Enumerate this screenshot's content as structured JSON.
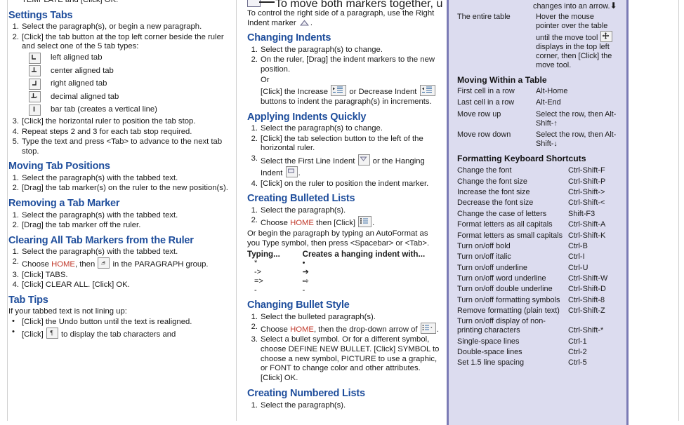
{
  "meta": {
    "doc_kind": "quick-reference-card",
    "accent_heading_color": "#1f4e9c",
    "accent_emphasis_color": "#c0392b",
    "panel_background_color": "#dcdcef",
    "panel_border_color": "#7b7bb5"
  },
  "left_column": {
    "top_cut_line": "TEMPLATE and [Click] OK.",
    "sections": [
      {
        "heading": "Settings Tabs",
        "steps": [
          "Select the paragraph(s), or begin a new paragraph.",
          "[Click] the tab button at the top left corner beside the ruler and select one of the 5 tab types:"
        ],
        "tab_types": [
          {
            "icon": "left-tab-icon",
            "label": "left aligned tab"
          },
          {
            "icon": "center-tab-icon",
            "label": "center aligned tab"
          },
          {
            "icon": "right-tab-icon",
            "label": "right aligned tab"
          },
          {
            "icon": "decimal-tab-icon",
            "label": "decimal aligned tab"
          },
          {
            "icon": "bar-tab-icon",
            "label": "bar tab (creates a vertical line)"
          }
        ],
        "steps_after": [
          "[Click] the horizontal ruler to position the tab stop.",
          "Repeat steps 2 and 3 for each tab stop required.",
          "Type the text and press <Tab> to advance to the next tab stop."
        ]
      },
      {
        "heading": "Moving Tab Positions",
        "steps": [
          "Select the paragraph(s) with the tabbed text.",
          "[Drag] the tab marker(s) on the ruler to the new position(s)."
        ]
      },
      {
        "heading": "Removing a Tab Marker",
        "steps": [
          "Select the paragraph(s) with the tabbed text.",
          "[Drag] the tab marker off the ruler."
        ]
      },
      {
        "heading": "Clearing All Tab Markers from the Ruler",
        "steps_parts": [
          {
            "plain": "Select the paragraph(s) with the tabbed text."
          },
          {
            "pre": "Choose ",
            "emph": "HOME",
            "mid": ", then ",
            "icon": "dialog-launcher-icon",
            "post": " in the PARAGRAPH group."
          },
          {
            "plain": "[Click] TABS."
          },
          {
            "plain": "[Click] CLEAR ALL. [Click] OK."
          }
        ]
      },
      {
        "heading": "Tab Tips",
        "intro": "If your tabbed text is not lining up:",
        "bullets": [
          {
            "plain": "[Click] the Undo button until the text is realigned."
          },
          {
            "pre": "[Click] ",
            "icon": "pilcrow-icon",
            "post": " to display the tab characters and"
          }
        ]
      }
    ]
  },
  "middle_column": {
    "top_note": "To move both markers together, use the Left Indent marker",
    "right_indent_note_pre": "To control the right side of a paragraph, use the Right Indent marker ",
    "right_indent_note_post": ".",
    "sections": [
      {
        "heading": "Changing Indents",
        "steps": [
          "Select the paragraph(s) to change.",
          "On the ruler, [Drag] the indent markers to the new position."
        ],
        "or_label": "Or",
        "or_line_pre": "[Click] the Increase ",
        "or_line_mid": " or Decrease Indent ",
        "or_line_post": "buttons to indent the paragraph(s) in increments."
      },
      {
        "heading": "Applying Indents Quickly",
        "steps": [
          "Select the paragraph(s) to change.",
          "[Click] the tab selection button to the left of the horizontal ruler."
        ],
        "step3_pre": "Select the First Line Indent ",
        "step3_mid": " or the Hanging Indent ",
        "step3_post": ".",
        "step4": "[Click] on the ruler to position the indent marker."
      },
      {
        "heading": "Creating Bulleted Lists",
        "step1": "Select the paragraph(s).",
        "step2_pre": "Choose ",
        "step2_emph": "HOME",
        "step2_mid": " then [Click] ",
        "step2_post": ".",
        "autoformat_note": "Or begin the paragraph by typing an AutoFormat as you Type symbol, then press <Spacebar> or <Tab>.",
        "typing_table": {
          "header_left": "Typing...",
          "header_right": "Creates a hanging indent with...",
          "rows": [
            {
              "typed": "*",
              "result": "•"
            },
            {
              "typed": "->",
              "result": "➔"
            },
            {
              "typed": "=>",
              "result": "⇨"
            },
            {
              "typed": "-",
              "result": "-"
            }
          ]
        }
      },
      {
        "heading": "Changing Bullet Style",
        "step1": "Select the bulleted paragraph(s).",
        "step2_pre": "Choose ",
        "step2_emph": "HOME",
        "step2_mid": ", then the drop-down arrow of ",
        "step2_post": ".",
        "step3": "Select a bullet symbol. Or for a different symbol, choose DEFINE NEW BULLET. [Click] SYMBOL to choose a new symbol, PICTURE to use a graphic, or FONT to change color and other attributes. [Click] OK."
      },
      {
        "heading": "Creating Numbered Lists",
        "step1_cut": "Select the paragraph(s)."
      }
    ]
  },
  "right_panel": {
    "top_cut_line": "changes into an arrow.",
    "moving_table_row": {
      "key": "The entire table",
      "value_pre": "Hover the mouse pointer over the table until the move tool ",
      "value_post": " displays in the top left corner, then [Click] the move tool."
    },
    "moving_within_table": {
      "heading": "Moving Within a Table",
      "rows": [
        {
          "action": "First cell in a row",
          "keys": "Alt-Home"
        },
        {
          "action": "Last cell in a row",
          "keys": "Alt-End"
        },
        {
          "action": "Move row up",
          "keys": "Select the row, then Alt-Shift-↑"
        },
        {
          "action": "Move row down",
          "keys": "Select the row, then Alt-Shift-↓"
        }
      ]
    },
    "formatting_shortcuts": {
      "heading": "Formatting Keyboard Shortcuts",
      "rows": [
        {
          "action": "Change the font",
          "keys": "Ctrl-Shift-F"
        },
        {
          "action": "Change the font size",
          "keys": "Ctrl-Shift-P"
        },
        {
          "action": "Increase the font size",
          "keys": "Ctrl-Shift->"
        },
        {
          "action": "Decrease the font size",
          "keys": "Ctrl-Shift-<"
        },
        {
          "action": "Change the case of letters",
          "keys": "Shift-F3"
        },
        {
          "action": "Format letters as all capitals",
          "keys": "Ctrl-Shift-A"
        },
        {
          "action": "Format letters as small capitals",
          "keys": "Ctrl-Shift-K"
        },
        {
          "action": "Turn on/off bold",
          "keys": "Ctrl-B"
        },
        {
          "action": "Turn on/off italic",
          "keys": "Ctrl-I"
        },
        {
          "action": "Turn on/off underline",
          "keys": "Ctrl-U"
        },
        {
          "action": "Turn on/off word underline",
          "keys": "Ctrl-Shift-W"
        },
        {
          "action": "Turn on/off double underline",
          "keys": "Ctrl-Shift-D"
        },
        {
          "action": "Turn on/off formatting symbols",
          "keys": "Ctrl-Shift-8"
        },
        {
          "action": "Remove formatting (plain text)",
          "keys": "Ctrl-Shift-Z"
        },
        {
          "action": "Turn on/off display of non-printing characters",
          "keys": "Ctrl-Shift-*"
        },
        {
          "action": "Single-space lines",
          "keys": "Ctrl-1"
        },
        {
          "action": "Double-space lines",
          "keys": "Ctrl-2"
        },
        {
          "action": "Set 1.5 line spacing",
          "keys": "Ctrl-5"
        }
      ]
    }
  }
}
